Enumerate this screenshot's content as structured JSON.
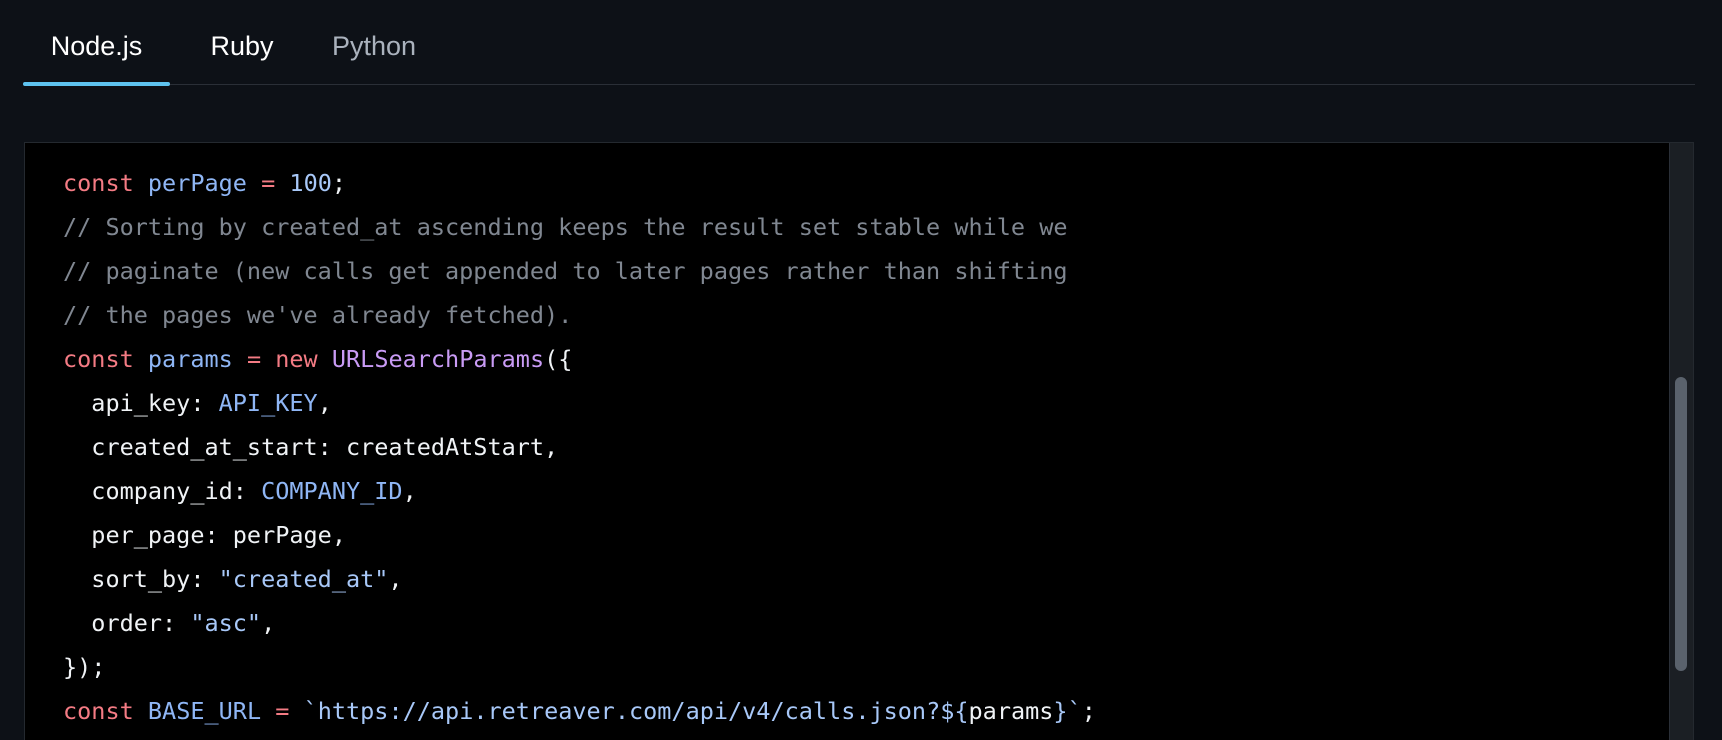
{
  "tabs": [
    {
      "label": "Node.js",
      "active": true
    },
    {
      "label": "Ruby",
      "active": false
    },
    {
      "label": "Python",
      "active": false
    }
  ],
  "colors": {
    "background": "#0d1117",
    "code_background": "#000000",
    "active_tab_underline": "#5ec3f0",
    "keyword": "#f47b84",
    "identifier": "#8fb6f5",
    "class_name": "#c99bf5",
    "comment": "#808791"
  },
  "code": {
    "lines": [
      [
        {
          "t": "kw",
          "v": "const"
        },
        {
          "t": "pl",
          "v": " "
        },
        {
          "t": "var",
          "v": "perPage"
        },
        {
          "t": "pl",
          "v": " "
        },
        {
          "t": "op",
          "v": "="
        },
        {
          "t": "pl",
          "v": " "
        },
        {
          "t": "num",
          "v": "100"
        },
        {
          "t": "pl",
          "v": ";"
        }
      ],
      [
        {
          "t": "cm",
          "v": "// Sorting by created_at ascending keeps the result set stable while we"
        }
      ],
      [
        {
          "t": "cm",
          "v": "// paginate (new calls get appended to later pages rather than shifting"
        }
      ],
      [
        {
          "t": "cm",
          "v": "// the pages we've already fetched)."
        }
      ],
      [
        {
          "t": "kw",
          "v": "const"
        },
        {
          "t": "pl",
          "v": " "
        },
        {
          "t": "var",
          "v": "params"
        },
        {
          "t": "pl",
          "v": " "
        },
        {
          "t": "op",
          "v": "="
        },
        {
          "t": "pl",
          "v": " "
        },
        {
          "t": "kw",
          "v": "new"
        },
        {
          "t": "pl",
          "v": " "
        },
        {
          "t": "cls",
          "v": "URLSearchParams"
        },
        {
          "t": "pl",
          "v": "({"
        }
      ],
      [
        {
          "t": "pl",
          "v": "  api_key: "
        },
        {
          "t": "var",
          "v": "API_KEY"
        },
        {
          "t": "pl",
          "v": ","
        }
      ],
      [
        {
          "t": "pl",
          "v": "  created_at_start: createdAtStart,"
        }
      ],
      [
        {
          "t": "pl",
          "v": "  company_id: "
        },
        {
          "t": "var",
          "v": "COMPANY_ID"
        },
        {
          "t": "pl",
          "v": ","
        }
      ],
      [
        {
          "t": "pl",
          "v": "  per_page: perPage,"
        }
      ],
      [
        {
          "t": "pl",
          "v": "  sort_by: "
        },
        {
          "t": "str",
          "v": "\"created_at\""
        },
        {
          "t": "pl",
          "v": ","
        }
      ],
      [
        {
          "t": "pl",
          "v": "  order: "
        },
        {
          "t": "str",
          "v": "\"asc\""
        },
        {
          "t": "pl",
          "v": ","
        }
      ],
      [
        {
          "t": "pl",
          "v": "});"
        }
      ],
      [
        {
          "t": "kw",
          "v": "const"
        },
        {
          "t": "pl",
          "v": " "
        },
        {
          "t": "var",
          "v": "BASE_URL"
        },
        {
          "t": "pl",
          "v": " "
        },
        {
          "t": "op",
          "v": "="
        },
        {
          "t": "pl",
          "v": " "
        },
        {
          "t": "str",
          "v": "`https://api.retreaver.com/api/v4/calls.json?${"
        },
        {
          "t": "pl",
          "v": "params"
        },
        {
          "t": "str",
          "v": "}`"
        },
        {
          "t": "pl",
          "v": ";"
        }
      ]
    ]
  },
  "scrollbar": {
    "position_fraction": 0.62
  }
}
